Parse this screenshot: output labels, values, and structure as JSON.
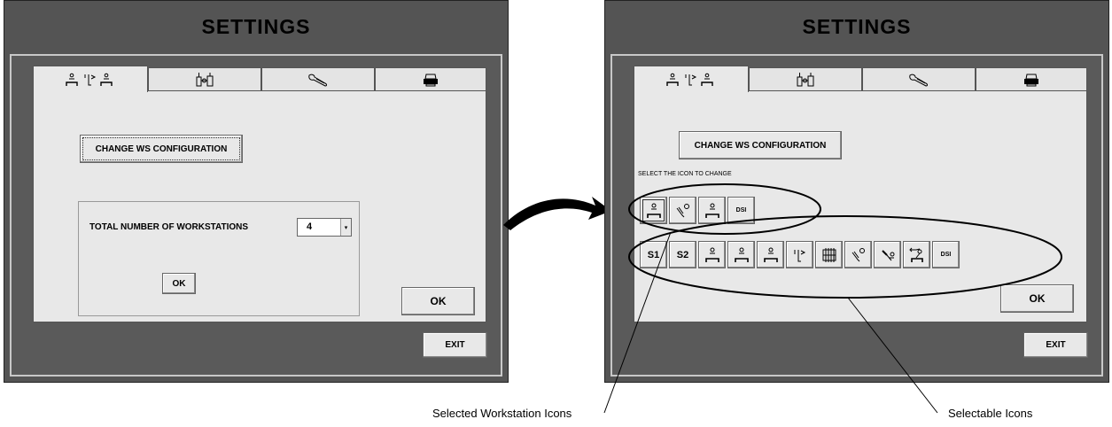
{
  "left_panel": {
    "title": "SETTINGS",
    "tabs": [
      {
        "icon": "workstation-layout-icon",
        "active": true
      },
      {
        "icon": "torque-tool-icon",
        "active": false
      },
      {
        "icon": "wrench-icon",
        "active": false
      },
      {
        "icon": "printer-icon",
        "active": false
      }
    ],
    "change_ws_label": "CHANGE WS CONFIGURATION",
    "total_label": "TOTAL NUMBER OF WORKSTATIONS",
    "total_value": "4",
    "group_ok_label": "OK",
    "ok_label": "OK",
    "exit_label": "EXIT"
  },
  "right_panel": {
    "title": "SETTINGS",
    "tabs": [
      {
        "icon": "workstation-layout-icon",
        "active": true
      },
      {
        "icon": "torque-tool-icon",
        "active": false
      },
      {
        "icon": "wrench-icon",
        "active": false
      },
      {
        "icon": "printer-icon",
        "active": false
      }
    ],
    "change_ws_label": "CHANGE WS CONFIGURATION",
    "select_label": "SELECT THE ICON TO CHANGE",
    "selected_icons": [
      {
        "icon": "operator-station-icon"
      },
      {
        "icon": "hand-tool-icon"
      },
      {
        "icon": "operator-station-icon"
      },
      {
        "label": "DSI"
      }
    ],
    "selectable_icons": [
      {
        "label": "S1"
      },
      {
        "label": "S2"
      },
      {
        "icon": "operator-station-icon"
      },
      {
        "icon": "operator-station-icon"
      },
      {
        "icon": "operator-station-icon"
      },
      {
        "icon": "fixture-icon"
      },
      {
        "icon": "rack-icon"
      },
      {
        "icon": "hand-tool-icon"
      },
      {
        "icon": "pliers-tool-icon"
      },
      {
        "icon": "robot-arm-icon"
      },
      {
        "label": "DSI"
      }
    ],
    "ok_label": "OK",
    "exit_label": "EXIT"
  },
  "captions": {
    "selected": "Selected Workstation Icons",
    "selectable": "Selectable Icons"
  }
}
